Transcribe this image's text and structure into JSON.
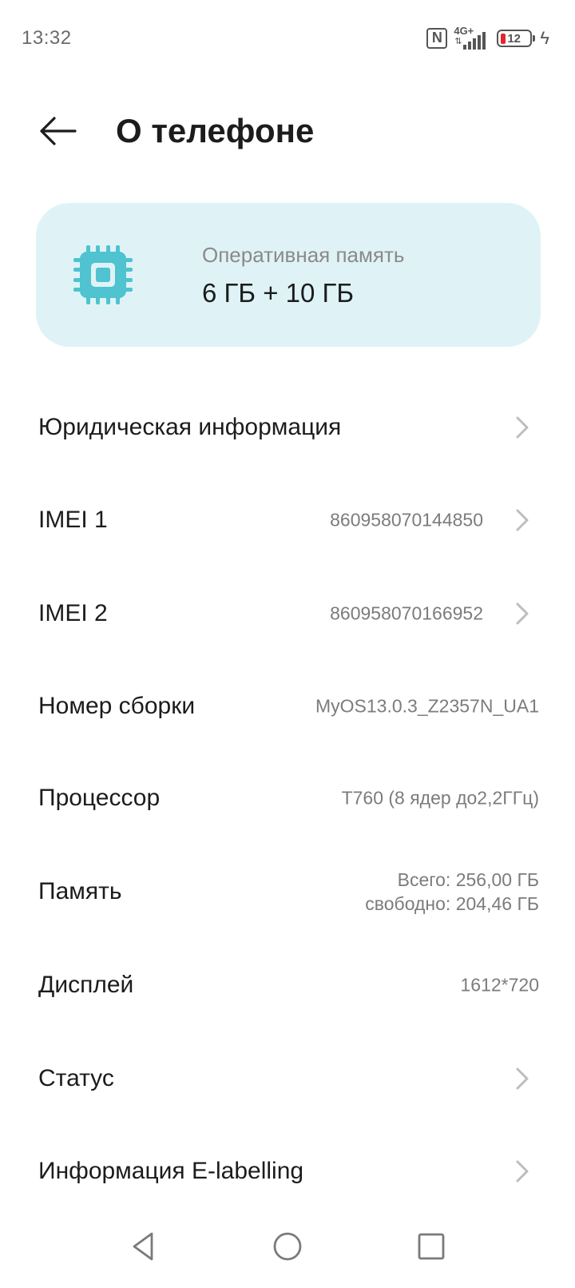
{
  "status_bar": {
    "time": "13:32",
    "nfc": "N",
    "network": "4G+",
    "battery": "12",
    "icons": [
      "nfc-icon",
      "signal-4g-icon",
      "battery-icon",
      "charging-icon"
    ]
  },
  "header": {
    "title": "О телефоне",
    "back_icon": "arrow-left-icon"
  },
  "ram_card": {
    "icon": "chip-icon",
    "accent_color": "#4fc3cf",
    "background_color": "#dff3f6",
    "label": "Оперативная память",
    "value": "6 ГБ + 10 ГБ"
  },
  "rows": [
    {
      "title": "Юридическая информация",
      "value": "",
      "chevron": true
    },
    {
      "title": "IMEI 1",
      "value": "860958070144850",
      "chevron": true
    },
    {
      "title": "IMEI 2",
      "value": "860958070166952",
      "chevron": true
    },
    {
      "title": "Номер сборки",
      "value": "MyOS13.0.3_Z2357N_UA1",
      "chevron": false
    },
    {
      "title": "Процессор",
      "value": "T760  (8 ядер до2,2ГГц)",
      "chevron": false
    },
    {
      "title": "Память",
      "value_line1": "Всего: 256,00 ГБ",
      "value_line2": "свободно:  204,46 ГБ",
      "chevron": false
    },
    {
      "title": "Дисплей",
      "value": "1612*720",
      "chevron": false
    },
    {
      "title": "Статус",
      "value": "",
      "chevron": true
    },
    {
      "title": "Информация E-labelling",
      "value": "",
      "chevron": true
    }
  ],
  "nav_bar": {
    "icons": [
      "back-triangle-icon",
      "home-circle-icon",
      "recents-square-icon"
    ]
  }
}
